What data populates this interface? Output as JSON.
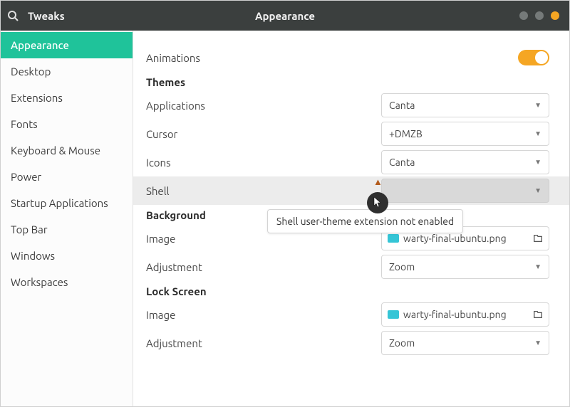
{
  "header": {
    "app_title": "Tweaks",
    "page_title": "Appearance"
  },
  "sidebar": {
    "items": [
      {
        "label": "Appearance",
        "active": true
      },
      {
        "label": "Desktop"
      },
      {
        "label": "Extensions"
      },
      {
        "label": "Fonts"
      },
      {
        "label": "Keyboard & Mouse"
      },
      {
        "label": "Power"
      },
      {
        "label": "Startup Applications"
      },
      {
        "label": "Top Bar"
      },
      {
        "label": "Windows"
      },
      {
        "label": "Workspaces"
      }
    ]
  },
  "content": {
    "animations_label": "Animations",
    "animations_on": true,
    "sections": {
      "themes": {
        "title": "Themes",
        "applications": {
          "label": "Applications",
          "value": "Canta"
        },
        "cursor": {
          "label": "Cursor",
          "value": "+DMZB"
        },
        "icons": {
          "label": "Icons",
          "value": "Canta"
        },
        "shell": {
          "label": "Shell",
          "value": "",
          "disabled": true,
          "tooltip": "Shell user-theme extension not enabled"
        }
      },
      "background": {
        "title": "Background",
        "image": {
          "label": "Image",
          "value": "warty-final-ubuntu.png"
        },
        "adjustment": {
          "label": "Adjustment",
          "value": "Zoom"
        }
      },
      "lockscreen": {
        "title": "Lock Screen",
        "image": {
          "label": "Image",
          "value": "warty-final-ubuntu.png"
        },
        "adjustment": {
          "label": "Adjustment",
          "value": "Zoom"
        }
      }
    }
  }
}
